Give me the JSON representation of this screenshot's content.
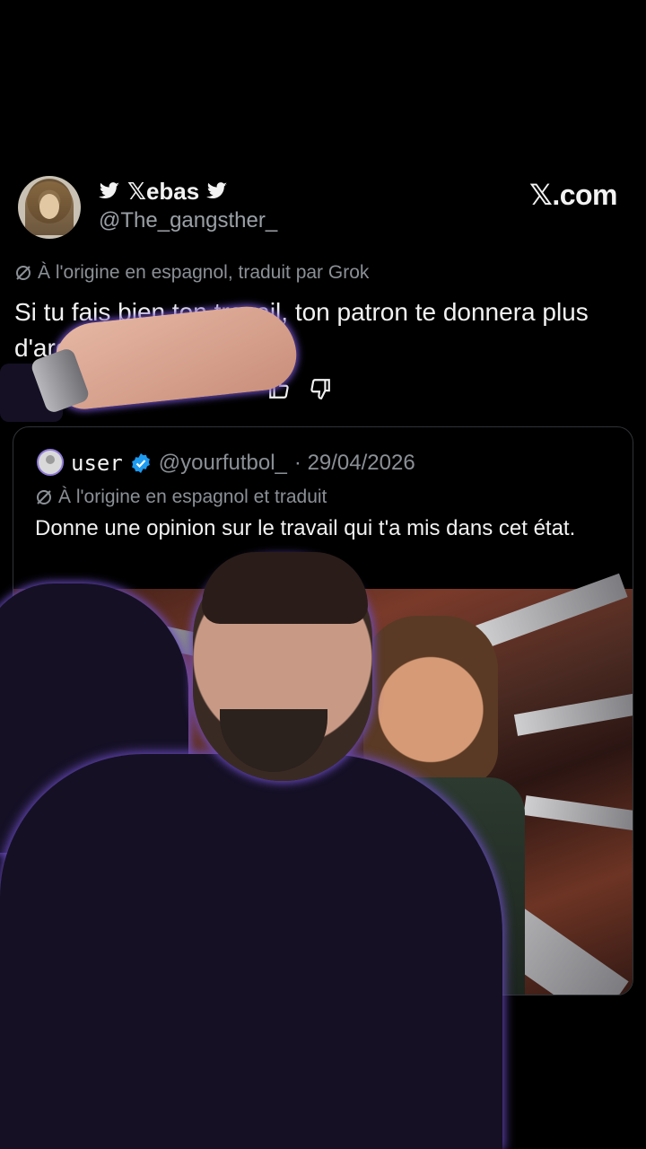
{
  "tweet": {
    "display_name": "𝕏ebas",
    "handle": "@The_gangsther_",
    "site_label": "𝕏.com",
    "translation_note": "À l'origine en espagnol, traduit par Grok",
    "text": "Si tu fais bien ton travail, ton patron te donnera plus d'argent."
  },
  "quote": {
    "username": "user",
    "handle": "@yourfutbol_",
    "date": "· 29/04/2026",
    "translation_note": "À l'origine en espagnol et traduit",
    "text": "Donne une opinion sur le travail qui t'a mis dans cet état."
  },
  "colors": {
    "background": "#000000",
    "text": "#f2f2f2",
    "muted": "#8b9096",
    "verified": "#1d9bf0",
    "glow": "#6b4cc2"
  },
  "icons": [
    "twitter-bird-icon",
    "grok-icon",
    "thumbs-up-icon",
    "thumbs-down-icon",
    "verified-badge-icon"
  ]
}
